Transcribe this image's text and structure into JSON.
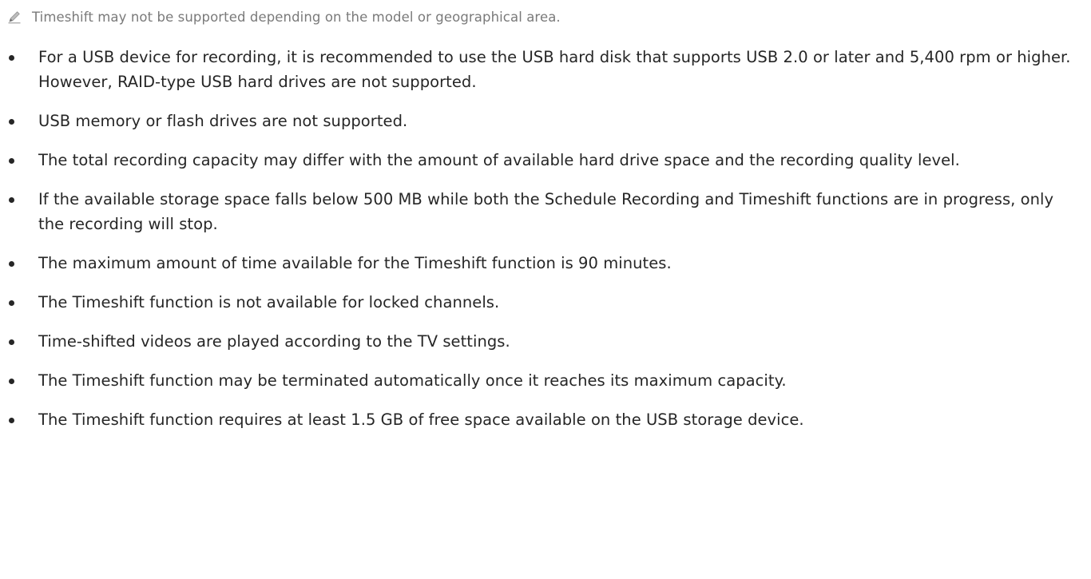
{
  "note": {
    "icon": "pencil-icon",
    "text": "Timeshift may not be supported depending on the model or geographical area."
  },
  "bullets": [
    "For a USB device for recording, it is recommended to use the USB hard disk that supports USB 2.0 or later and 5,400 rpm or higher. However, RAID-type USB hard drives are not supported.",
    "USB memory or flash drives are not supported.",
    "The total recording capacity may differ with the amount of available hard drive space and the recording quality level.",
    "If the available storage space falls below 500 MB while both the Schedule Recording and Timeshift functions are in progress, only the recording will stop.",
    "The maximum amount of time available for the Timeshift function is 90 minutes.",
    "The Timeshift function is not available for locked channels.",
    "Time-shifted videos are played according to the TV settings.",
    "The Timeshift function may be terminated automatically once it reaches its maximum capacity.",
    "The Timeshift function requires at least 1.5 GB of free space available on the USB storage device."
  ],
  "colors": {
    "text": "#262626",
    "note_text": "#7a7a7a",
    "icon": "#9a9a9a"
  }
}
